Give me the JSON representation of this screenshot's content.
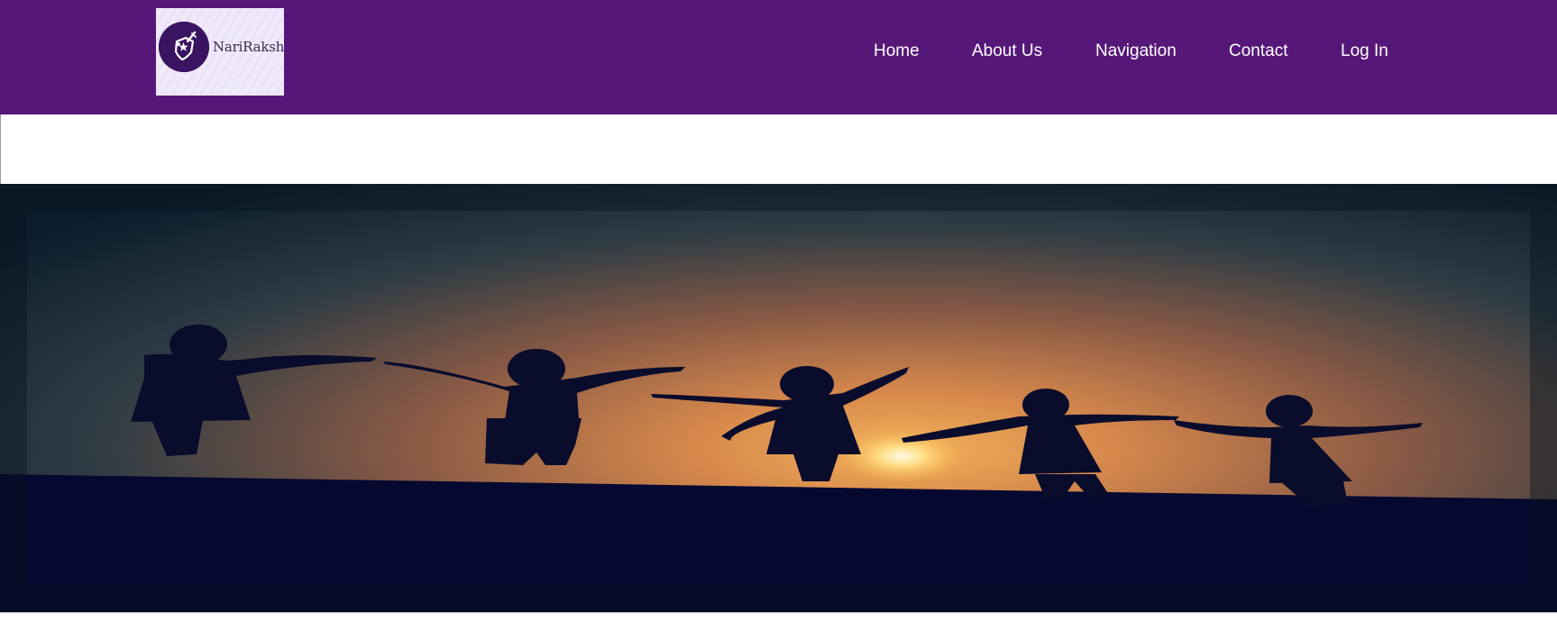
{
  "brand": {
    "name": "NariRaksha",
    "logo_icon": "shield-sword-icon"
  },
  "nav": {
    "items": [
      {
        "label": "Home"
      },
      {
        "label": "About Us"
      },
      {
        "label": "Navigation"
      },
      {
        "label": "Contact"
      },
      {
        "label": "Log In"
      }
    ]
  },
  "hero": {
    "image_subject": "five-silhouettes-at-sunset"
  },
  "colors": {
    "header_bg": "#561878",
    "logo_bg": "#efe9fb",
    "nav_text": "#ffffff",
    "hero_ground": "#050930",
    "sun": "#fff3c0"
  }
}
